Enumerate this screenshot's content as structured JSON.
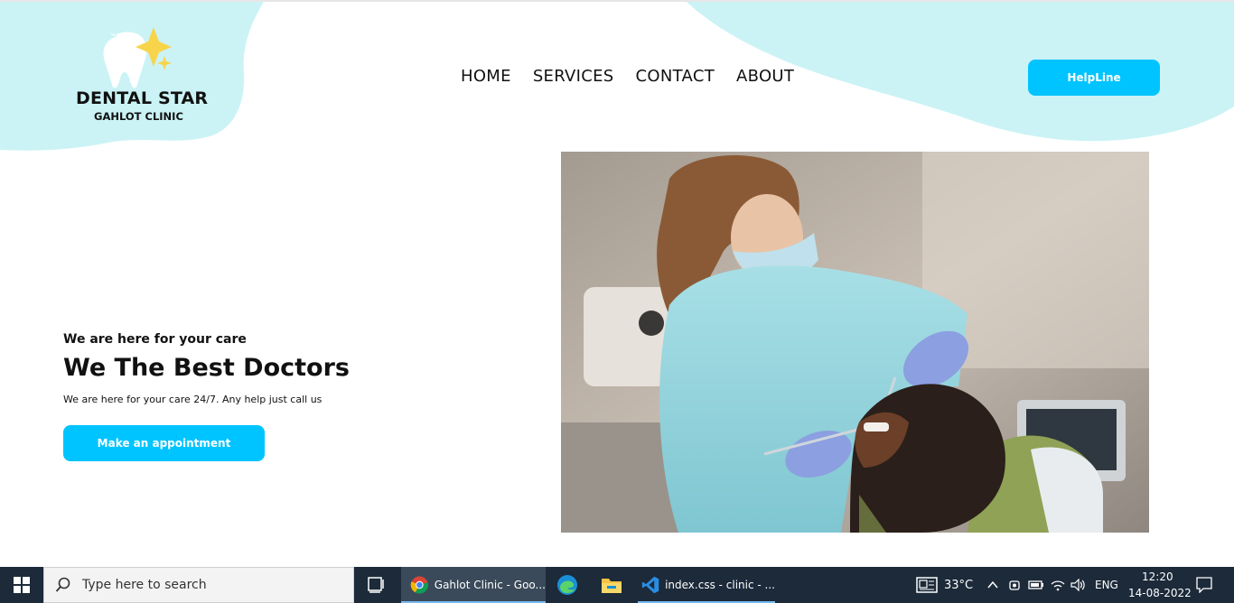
{
  "logo": {
    "title": "DENTAL STAR",
    "subtitle": "GAHLOT CLINIC"
  },
  "nav": {
    "items": [
      "HOME",
      "SERVICES",
      "CONTACT",
      "ABOUT"
    ]
  },
  "helpline": {
    "label": "HelpLine"
  },
  "hero": {
    "eyebrow": "We are here for your care",
    "title": "We The Best Doctors",
    "description": "We are here for your care 24/7. Any help just call us",
    "cta": "Make an appointment"
  },
  "colors": {
    "accent": "#00c4ff",
    "blob": "#cbf3f6"
  },
  "taskbar": {
    "search_placeholder": "Type here to search",
    "apps": [
      {
        "label": "Gahlot Clinic - Goo...",
        "icon": "chrome-icon"
      },
      {
        "label": "",
        "icon": "edge-icon"
      },
      {
        "label": "",
        "icon": "file-explorer-icon"
      },
      {
        "label": "index.css - clinic - ...",
        "icon": "vscode-icon"
      }
    ],
    "weather": "33°C",
    "language": "ENG",
    "time": "12:20",
    "date": "14-08-2022"
  }
}
